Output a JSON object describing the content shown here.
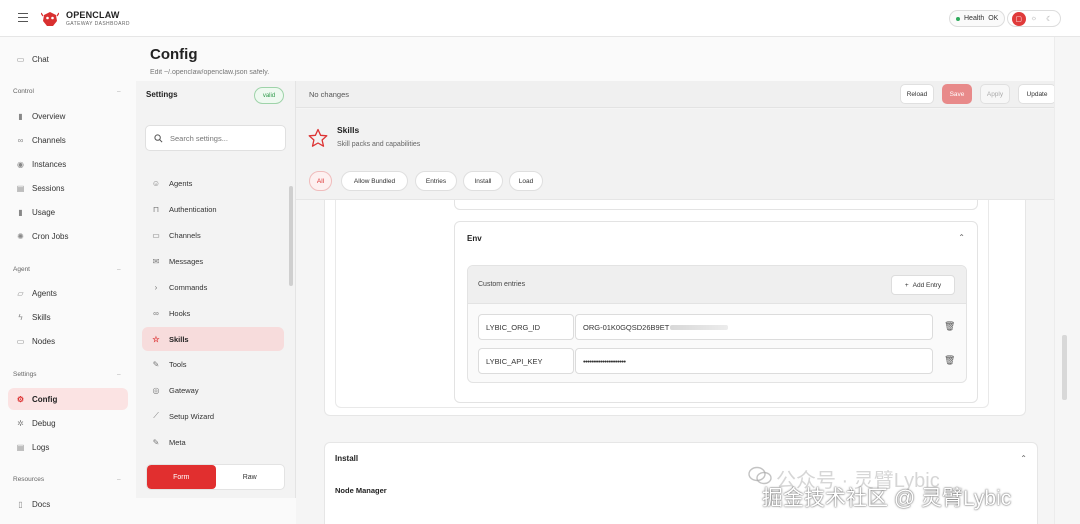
{
  "app": {
    "name": "OPENCLAW",
    "subtitle": "GATEWAY DASHBOARD",
    "health_label": "Health",
    "health_status": "OK"
  },
  "nav": {
    "chat": "Chat",
    "group_control": "Control",
    "overview": "Overview",
    "channels": "Channels",
    "instances": "Instances",
    "sessions": "Sessions",
    "usage": "Usage",
    "cron_jobs": "Cron Jobs",
    "group_agent": "Agent",
    "agents": "Agents",
    "skills": "Skills",
    "nodes": "Nodes",
    "group_settings": "Settings",
    "config": "Config",
    "debug": "Debug",
    "logs": "Logs",
    "group_resources": "Resources",
    "docs": "Docs"
  },
  "page": {
    "title": "Config",
    "subtitle": "Edit ~/.openclaw/openclaw.json safely."
  },
  "settings": {
    "title": "Settings",
    "valid_badge": "valid",
    "search_placeholder": "Search settings...",
    "items": [
      "Agents",
      "Authentication",
      "Channels",
      "Messages",
      "Commands",
      "Hooks",
      "Skills",
      "Tools",
      "Gateway",
      "Setup Wizard",
      "Meta"
    ],
    "mode_form": "Form",
    "mode_raw": "Raw"
  },
  "actionbar": {
    "status": "No changes",
    "reload": "Reload",
    "save": "Save",
    "apply": "Apply",
    "update": "Update"
  },
  "section": {
    "title": "Skills",
    "subtitle": "Skill packs and capabilities"
  },
  "chips": [
    "All",
    "Allow Bundled",
    "Entries",
    "Install",
    "Load"
  ],
  "env": {
    "title": "Env",
    "custom_entries_label": "Custom entries",
    "add_entry_label": "Add Entry",
    "rows": [
      {
        "key": "LYBIC_ORG_ID",
        "value": "ORG-01K0GQSD26B9ET"
      },
      {
        "key": "LYBIC_API_KEY",
        "value": "••••••••••••••••••••"
      }
    ]
  },
  "install": {
    "title": "Install",
    "node_manager_label": "Node Manager"
  },
  "watermark": {
    "top": "公众号 · 灵臂Lybic",
    "bottom": "掘金技术社区 @ 灵臂Lybic"
  },
  "colors": {
    "accent": "#e12f2f",
    "active_bg": "#fbe3e3",
    "health_dot": "#2eaa5c"
  }
}
